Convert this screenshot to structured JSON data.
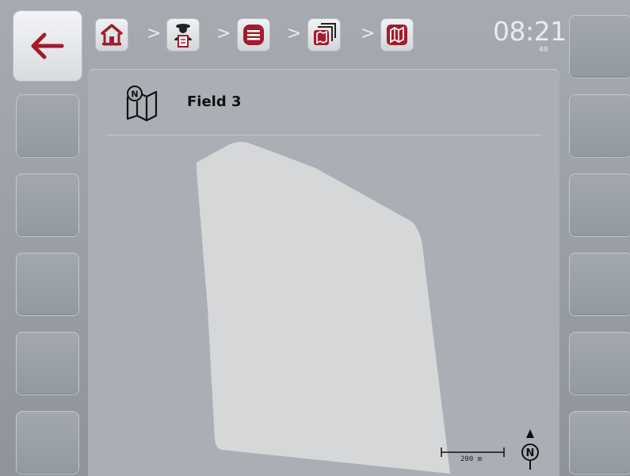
{
  "header": {
    "time": "08:21",
    "time_sub": "49",
    "breadcrumb": [
      {
        "icon": "home-icon"
      },
      {
        "icon": "farmer-task-icon"
      },
      {
        "icon": "menu-icon"
      },
      {
        "icon": "fields-list-icon"
      },
      {
        "icon": "field-icon"
      }
    ],
    "separator": ">"
  },
  "content": {
    "field_name": "Field 3",
    "scale_label": "200 m",
    "north_label": "N"
  },
  "colors": {
    "accent": "#a11c2c",
    "field_fill": "#d6d8da",
    "panel": "#a9afb5"
  }
}
